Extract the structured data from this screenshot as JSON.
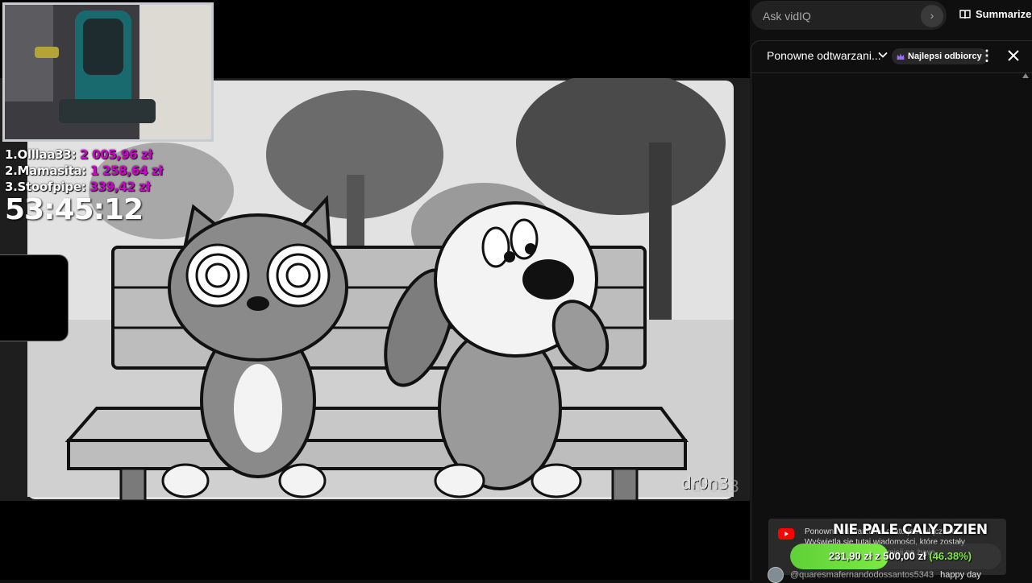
{
  "leaderboard": [
    {
      "rank": "1.",
      "name": "Olllaa33:",
      "amount": "2 005,96 zł"
    },
    {
      "rank": "2.",
      "name": "Mamasita:",
      "amount": "1 258,64 zł"
    },
    {
      "rank": "3.",
      "name": "Stoofpipe:",
      "amount": "339,42 zł"
    }
  ],
  "timer": "53:45:12",
  "watermark": "dr0n3",
  "vidiq": {
    "placeholder": "Ask vidIQ",
    "summarize_label": "Summarize"
  },
  "chat": {
    "mode_label": "Ponowne odtwarzani...",
    "badge_label": "Najlepsi odbiorcy",
    "notice_text": "Ponowne odtwarzanie czatu jest włączone. Wyświetla się tutaj wiadomości, które zostały wysłane w czasie transmisji na żywo.",
    "message": {
      "author": "@quaresmafernandodossantos5343",
      "text": "happy day"
    }
  },
  "goal": {
    "title": "NIE PALE CALY DZIEN",
    "current": "231,90 zł",
    "separator": "z",
    "target": "500,00 zł",
    "percent_label": "(46.38%)",
    "progress": 0.4638
  },
  "colors": {
    "donation": "#d100d1",
    "goal_fill": "#6ddc3c",
    "youtube_red": "#ff0000"
  }
}
